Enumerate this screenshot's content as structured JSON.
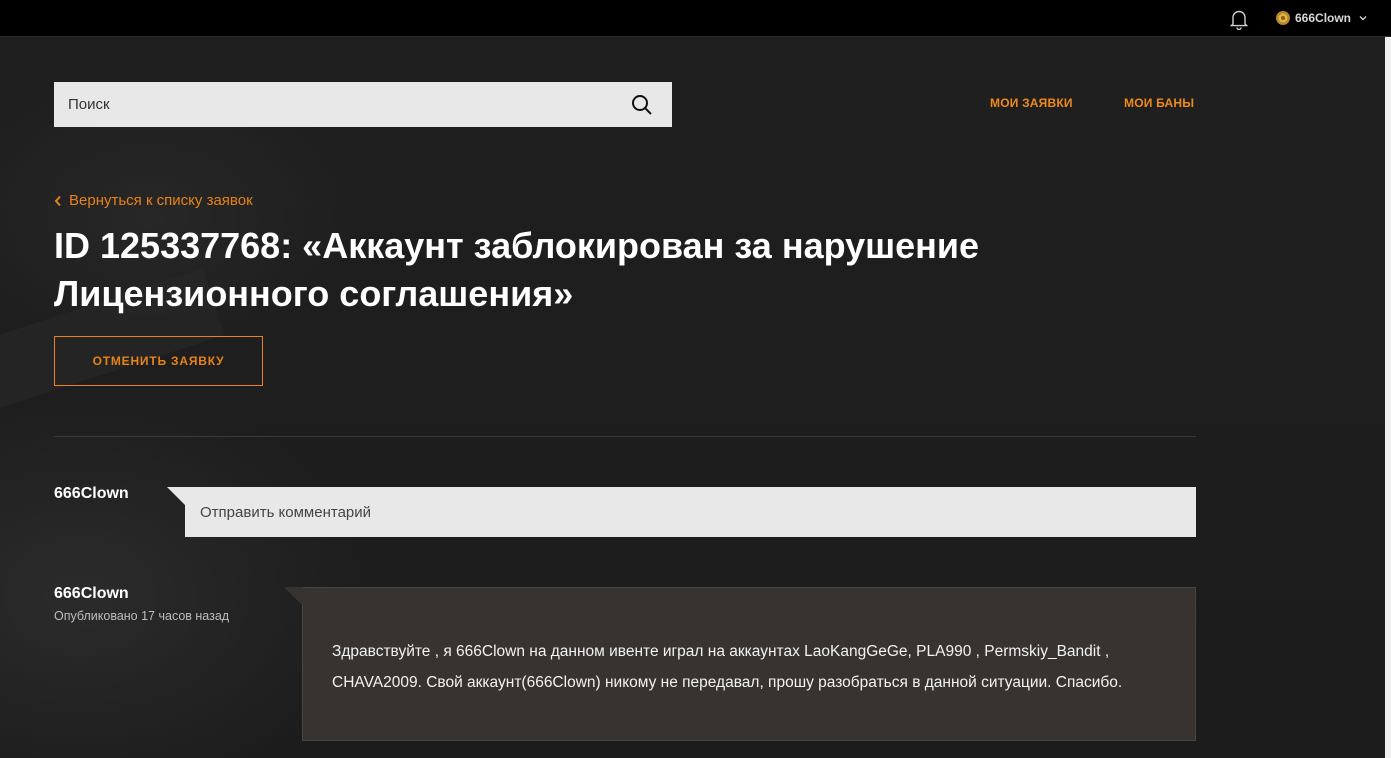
{
  "topbar": {
    "username": "666Clown",
    "icons": {
      "notifications": "bell-icon",
      "emblem": "user-emblem-icon",
      "menu": "chevron-down-icon"
    }
  },
  "search": {
    "placeholder": "Поиск",
    "icon": "search-icon"
  },
  "nav": {
    "my_requests": "МОИ ЗАЯВКИ",
    "my_bans": "МОИ БАНЫ"
  },
  "back_link": {
    "label": "Вернуться к списку заявок",
    "icon": "chevron-left-icon"
  },
  "ticket": {
    "title": "ID 125337768: «Аккаунт заблокирован за нарушение Лицензионного соглашения»",
    "cancel_label": "ОТМЕНИТЬ ЗАЯВКУ"
  },
  "comment_form": {
    "author": "666Clown",
    "placeholder": "Отправить комментарий"
  },
  "messages": [
    {
      "author": "666Clown",
      "published": "Опубликовано 17 часов назад",
      "text": "Здравствуйте , я 666Clown на данном ивенте играл на аккаунтах LaoKangGeGe, PLA990 , Permskiy_Bandit , CHAVA2009. Свой аккаунт(666Clown) никому не передавал, прошу разобраться в данной ситуации. Спасибо."
    }
  ],
  "colors": {
    "accent": "#e8821a",
    "background": "#1e1e1e",
    "topbar": "#000000",
    "message_bg": "#38332f",
    "input_bg": "#e8e8e8"
  }
}
